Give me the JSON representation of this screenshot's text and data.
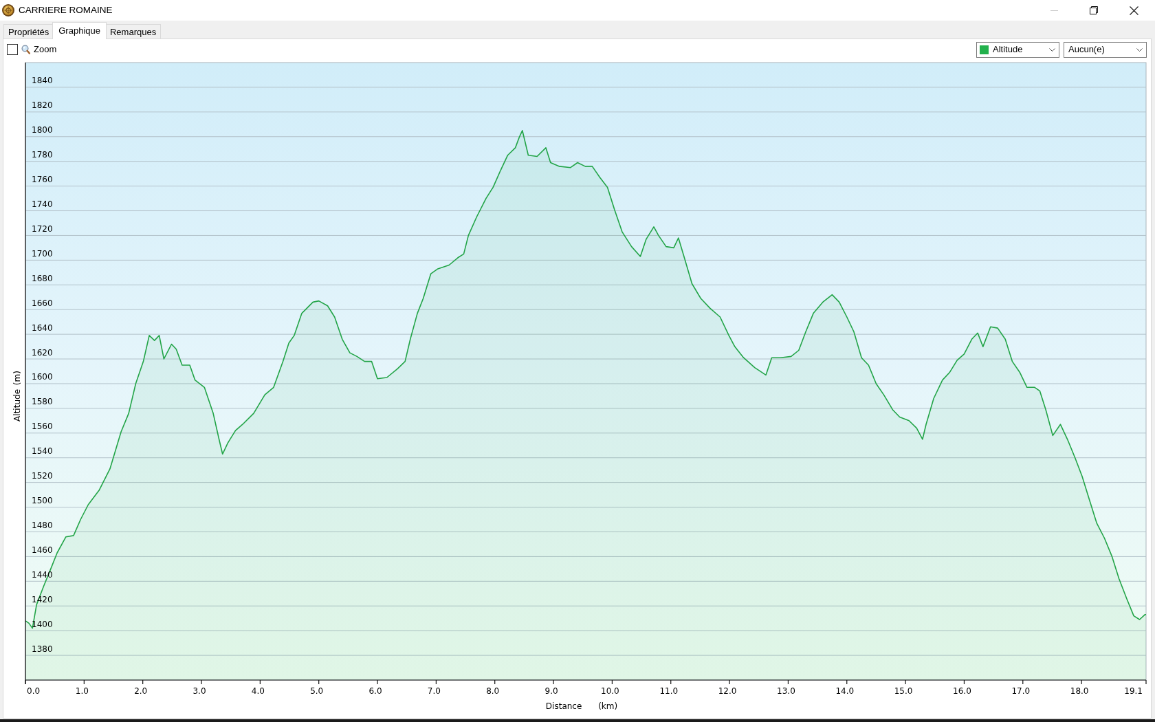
{
  "window": {
    "title": "CARRIERE ROMAINE",
    "buttons": [
      {
        "kind": "minimize",
        "disabled": true
      },
      {
        "kind": "restore",
        "disabled": false
      },
      {
        "kind": "close",
        "disabled": false
      }
    ]
  },
  "tabs": [
    {
      "label": "Propriétés",
      "selected": false
    },
    {
      "label": "Graphique",
      "selected": true
    },
    {
      "label": "Remarques",
      "selected": false
    }
  ],
  "toolbar": {
    "zoom": {
      "label": "Zoom",
      "checked": false
    },
    "dropdowns": [
      {
        "value": "Altitude",
        "color": "#22b14c"
      },
      {
        "value": "Aucun(e)"
      }
    ]
  },
  "chart": {
    "chart_data": {
      "type": "area",
      "xlabel": "Distance (km)",
      "ylabel": "Altitude (m)",
      "grid": true,
      "x": [
        0,
        0.06,
        0.12,
        0.19,
        0.31,
        0.44,
        0.54,
        0.69,
        0.82,
        0.94,
        1.07,
        1.26,
        1.44,
        1.63,
        1.76,
        1.88,
        2.01,
        2.11,
        2.2,
        2.28,
        2.36,
        2.49,
        2.57,
        2.67,
        2.8,
        2.89,
        3.05,
        3.2,
        3.3,
        3.36,
        3.45,
        3.58,
        3.7,
        3.89,
        4.08,
        4.23,
        4.39,
        4.49,
        4.58,
        4.71,
        4.9,
        5.0,
        5.15,
        5.27,
        5.4,
        5.53,
        5.65,
        5.78,
        5.9,
        6.0,
        6.16,
        6.34,
        6.47,
        6.56,
        6.68,
        6.78,
        6.91,
        7.03,
        7.22,
        7.37,
        7.47,
        7.55,
        7.69,
        7.85,
        7.97,
        8.1,
        8.22,
        8.35,
        8.42,
        8.47,
        8.57,
        8.72,
        8.87,
        8.95,
        9.1,
        9.29,
        9.41,
        9.54,
        9.66,
        9.79,
        9.92,
        10.04,
        10.17,
        10.33,
        10.48,
        10.58,
        10.71,
        10.79,
        10.92,
        11.05,
        11.13,
        11.23,
        11.36,
        11.51,
        11.67,
        11.84,
        11.99,
        12.09,
        12.24,
        12.43,
        12.62,
        12.72,
        12.87,
        13.05,
        13.18,
        13.3,
        13.43,
        13.59,
        13.75,
        13.87,
        14.0,
        14.12,
        14.25,
        14.37,
        14.5,
        14.63,
        14.78,
        14.9,
        15.06,
        15.19,
        15.29,
        15.35,
        15.48,
        15.63,
        15.75,
        15.88,
        16.0,
        16.13,
        16.23,
        16.32,
        16.45,
        16.57,
        16.7,
        16.82,
        16.95,
        17.07,
        17.2,
        17.29,
        17.39,
        17.51,
        17.64,
        17.76,
        17.89,
        18.01,
        18.14,
        18.26,
        18.39,
        18.52,
        18.64,
        18.77,
        18.89,
        18.99,
        19.08,
        19.1
      ],
      "series": [
        {
          "color": "#22a447",
          "values": [
            1408,
            1406,
            1402,
            1421,
            1436,
            1451,
            1463,
            1476,
            1477,
            1490,
            1502,
            1514,
            1531,
            1561,
            1576,
            1600,
            1618,
            1639,
            1635,
            1639,
            1620,
            1632,
            1628,
            1615,
            1615,
            1603,
            1597,
            1576,
            1555,
            1543,
            1552,
            1562,
            1567,
            1576,
            1591,
            1597,
            1618,
            1633,
            1639,
            1657,
            1666,
            1667,
            1663,
            1654,
            1636,
            1625,
            1622,
            1618,
            1618,
            1604,
            1605,
            1612,
            1618,
            1636,
            1657,
            1669,
            1689,
            1693,
            1696,
            1702,
            1705,
            1720,
            1735,
            1750,
            1759,
            1773,
            1785,
            1791,
            1800,
            1805,
            1785,
            1784,
            1791,
            1779,
            1776,
            1775,
            1779,
            1776,
            1776,
            1767,
            1759,
            1741,
            1723,
            1711,
            1703,
            1717,
            1727,
            1720,
            1711,
            1710,
            1718,
            1702,
            1681,
            1669,
            1661,
            1654,
            1639,
            1630,
            1621,
            1613,
            1607,
            1621,
            1621,
            1622,
            1627,
            1642,
            1657,
            1666,
            1672,
            1666,
            1654,
            1642,
            1621,
            1615,
            1600,
            1591,
            1579,
            1573,
            1570,
            1564,
            1555,
            1567,
            1588,
            1603,
            1609,
            1619,
            1624,
            1636,
            1641,
            1630,
            1646,
            1645,
            1636,
            1618,
            1609,
            1597,
            1597,
            1594,
            1579,
            1558,
            1567,
            1555,
            1540,
            1525,
            1505,
            1487,
            1475,
            1460,
            1442,
            1426,
            1412,
            1409,
            1413,
            1413
          ]
        }
      ],
      "xlim": [
        0,
        19.1
      ],
      "ylim": [
        1360,
        1860
      ],
      "xticks": [
        {
          "value": 0,
          "label": "0.0"
        },
        {
          "value": 1,
          "label": "1.0"
        },
        {
          "value": 2,
          "label": "2.0"
        },
        {
          "value": 3,
          "label": "3.0"
        },
        {
          "value": 4,
          "label": "4.0"
        },
        {
          "value": 5,
          "label": "5.0"
        },
        {
          "value": 6,
          "label": "6.0"
        },
        {
          "value": 7,
          "label": "7.0"
        },
        {
          "value": 8,
          "label": "8.0"
        },
        {
          "value": 9,
          "label": "9.0"
        },
        {
          "value": 10,
          "label": "10.0"
        },
        {
          "value": 11,
          "label": "11.0"
        },
        {
          "value": 12,
          "label": "12.0"
        },
        {
          "value": 13,
          "label": "13.0"
        },
        {
          "value": 14,
          "label": "14.0"
        },
        {
          "value": 15,
          "label": "15.0"
        },
        {
          "value": 16,
          "label": "16.0"
        },
        {
          "value": 17,
          "label": "17.0"
        },
        {
          "value": 18,
          "label": "18.0"
        },
        {
          "value": 19.1,
          "label": "19.1"
        }
      ],
      "yticks": [
        1380,
        1400,
        1420,
        1440,
        1460,
        1480,
        1500,
        1520,
        1540,
        1560,
        1580,
        1600,
        1620,
        1640,
        1660,
        1680,
        1700,
        1720,
        1740,
        1760,
        1780,
        1800,
        1820,
        1840
      ]
    }
  }
}
